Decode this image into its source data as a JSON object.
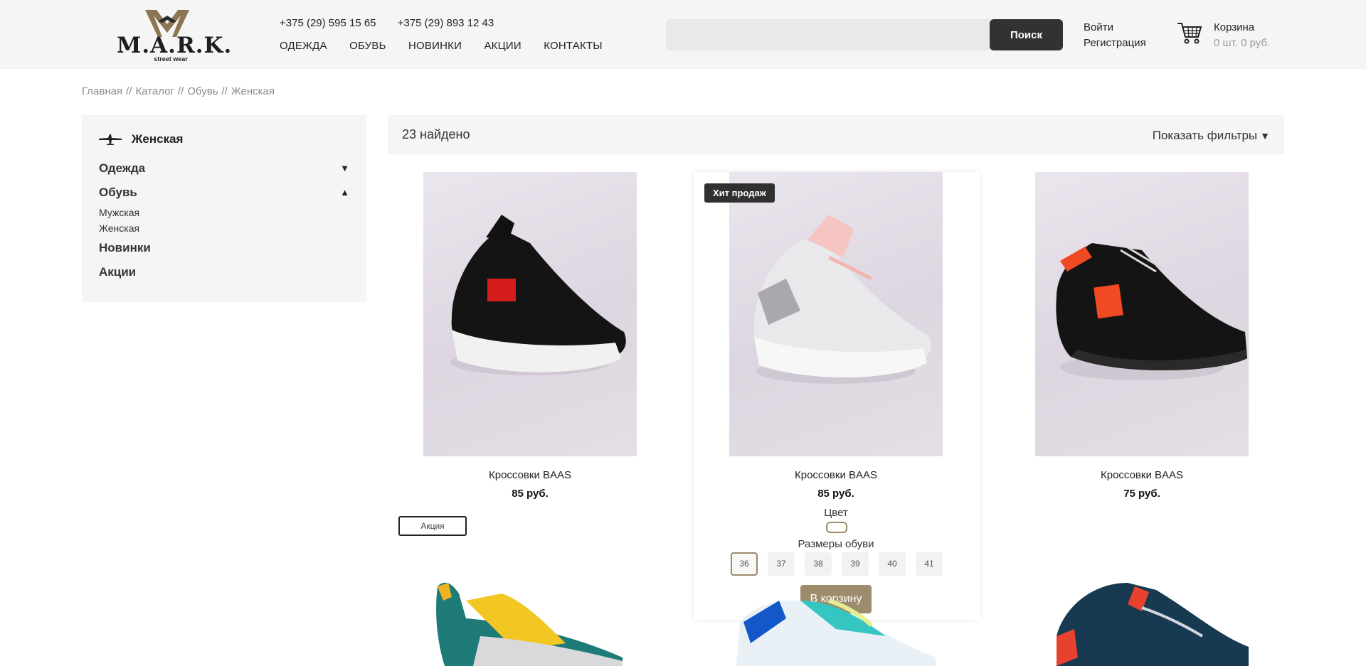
{
  "header": {
    "logo_text": "M.A.R.K.",
    "logo_sub": "street wear",
    "phones": [
      "+375 (29) 595 15 65",
      "+375 (29) 893 12 43"
    ],
    "nav": [
      "ОДЕЖДА",
      "ОБУВЬ",
      "НОВИНКИ",
      "АКЦИИ",
      "КОНТАКТЫ"
    ],
    "search": {
      "placeholder": "",
      "button": "Поиск"
    },
    "auth": {
      "login": "Войти",
      "register": "Регистрация"
    },
    "cart": {
      "title": "Корзина",
      "summary": "0 шт. 0 руб."
    }
  },
  "breadcrumb": [
    "Главная",
    "Каталог",
    "Обувь",
    "Женская"
  ],
  "sidebar": {
    "title": "Женская",
    "items": [
      {
        "label": "Одежда",
        "arrow": "▼"
      },
      {
        "label": "Обувь",
        "arrow": "▲",
        "sub": [
          "Мужская",
          "Женская"
        ]
      },
      {
        "label": "Новинки"
      },
      {
        "label": "Акции"
      }
    ]
  },
  "results": {
    "found": "23 найдено",
    "filters": "Показать фильтры",
    "filters_arrow": "▼"
  },
  "products": [
    {
      "name": "Кроссовки BAAS",
      "price": "85 руб.",
      "badge": "Акция",
      "colors": [
        "#1a1a1a",
        "#d21a1a",
        "#f2f2f2"
      ]
    },
    {
      "name": "Кроссовки BAAS",
      "price": "85 руб.",
      "badge": "Хит продаж",
      "color_label": "Цвет",
      "size_label": "Размеры обуви",
      "sizes": [
        "36",
        "37",
        "38",
        "39",
        "40",
        "41"
      ],
      "selected_size": "36",
      "cart_button": "В корзину",
      "colors": [
        "#f4f4f4",
        "#f7c4c4",
        "#b8b8b8"
      ]
    },
    {
      "name": "Кроссовки BAAS",
      "price": "75 руб.",
      "colors": [
        "#151515",
        "#f04a24",
        "#202020"
      ]
    }
  ],
  "accent": "#9c8c6c"
}
